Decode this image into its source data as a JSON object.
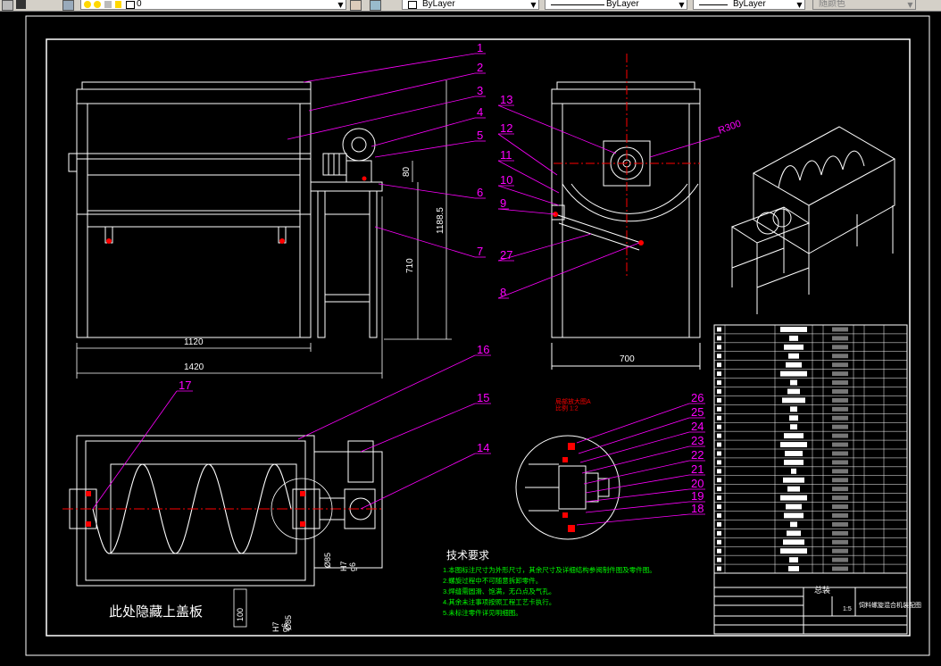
{
  "toolbar": {
    "layer_value": "0",
    "color_value": "ByLayer",
    "linetype_value": "ByLayer",
    "lineweight_value": "ByLayer",
    "plotstyle_value": "随颜色"
  },
  "balloons": [
    "1",
    "2",
    "3",
    "4",
    "5",
    "6",
    "7",
    "13",
    "12",
    "11",
    "10",
    "9",
    "27",
    "8",
    "17",
    "16",
    "15",
    "14",
    "26",
    "25",
    "24",
    "23",
    "22",
    "21",
    "20",
    "19",
    "18"
  ],
  "dimensions": {
    "width_1120": "1120",
    "width_1420": "1420",
    "height_1188": "1188.5",
    "height_710": "710",
    "height_80": "80",
    "width_700": "700",
    "radius": "R300",
    "fit_h7g6_a": "H7\ng6",
    "fit_h7g6_b": "H7\ng6",
    "dia_85": "Ø85",
    "box_100": "100",
    "box_b": "Ø85"
  },
  "notes": {
    "title": "技术要求",
    "items": [
      "1.本图标注尺寸为外形尺寸，其余尺寸及详细结构参阅制件图及零件图。",
      "2.螺旋过程中不可随意拆卸零件。",
      "3.焊缝需圆滑、饱满，无凸点及气孔。",
      "4.其余未注事项按照工程工艺卡执行。",
      "5.未标注零件详见明细图。"
    ]
  },
  "hidden_cover_note": "此处隐藏上盖板",
  "detail_label": "局部放大图A\n比例 1:2",
  "title_block": {
    "drawing_title": "饲料螺旋混合机装配图",
    "scale_cell": "1:5",
    "project": "总装"
  },
  "colors": {
    "magenta": "#ff00ff",
    "white": "#ffffff",
    "red": "#ff0000",
    "green": "#00ff00",
    "yellow": "#ffff00",
    "cyan": "#00ffff"
  }
}
